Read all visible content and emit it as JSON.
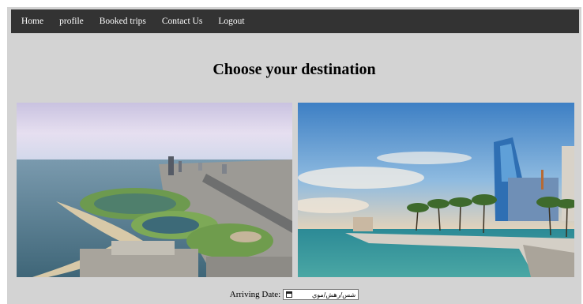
{
  "nav": {
    "items": [
      {
        "label": "Home"
      },
      {
        "label": "profile"
      },
      {
        "label": "Booked trips"
      },
      {
        "label": "Contact Us"
      },
      {
        "label": "Logout"
      }
    ]
  },
  "heading": "Choose your destination",
  "arriving": {
    "label": "Arriving Date:",
    "value": "شس/رهش/موي"
  },
  "colors": {
    "navbar": "#333333",
    "page_bg": "#d3d3d3",
    "nav_text": "#ffffff"
  }
}
